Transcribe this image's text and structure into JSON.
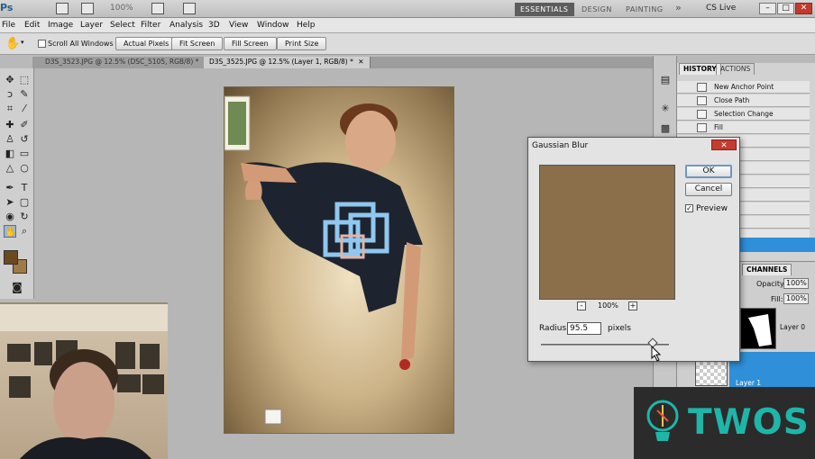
{
  "app": {
    "logo": "Ps",
    "zoom": "100%",
    "workspaces": [
      "ESSENTIALS",
      "DESIGN",
      "PAINTING"
    ],
    "more": "»",
    "cs_live": "CS Live",
    "window_buttons": [
      "–",
      "□",
      "✕"
    ]
  },
  "menu": [
    "File",
    "Edit",
    "Image",
    "Layer",
    "Select",
    "Filter",
    "Analysis",
    "3D",
    "View",
    "Window",
    "Help"
  ],
  "options": {
    "scroll_all": "Scroll All Windows",
    "buttons": [
      "Actual Pixels",
      "Fit Screen",
      "Fill Screen",
      "Print Size"
    ]
  },
  "tabs": [
    {
      "label": "D3S_3523.JPG @ 12.5% (DSC_5105, RGB/8) *",
      "close": "✕"
    },
    {
      "label": "D3S_3525.JPG @ 12.5% (Layer 1, RGB/8) *",
      "close": "✕"
    }
  ],
  "colors": {
    "foreground": "#6b4a1f",
    "background": "#a07b45",
    "blur_preview": "#8a6f4a",
    "accent": "#2f8fd8",
    "logo_teal": "#1fb5a9"
  },
  "history": {
    "tabs": [
      "HISTORY",
      "ACTIONS"
    ],
    "items": [
      "New Anchor Point",
      "Close Path",
      "Selection Change",
      "Fill"
    ]
  },
  "layers": {
    "tab": "CHANNELS",
    "opacity_label": "Opacity:",
    "opacity": "100%",
    "fill_label": "Fill:",
    "fill": "100%",
    "layer0": "Layer 0",
    "layer1": "Layer 1"
  },
  "dialog": {
    "title": "Gaussian Blur",
    "ok": "OK",
    "cancel": "Cancel",
    "preview": "Preview",
    "preview_checked": true,
    "zoom": "100%",
    "zoom_out": "-",
    "zoom_in": "+",
    "radius_label": "Radius:",
    "radius": "95.5",
    "units": "pixels",
    "radius_fraction": 0.87
  },
  "logo": {
    "word": "TWOS"
  }
}
